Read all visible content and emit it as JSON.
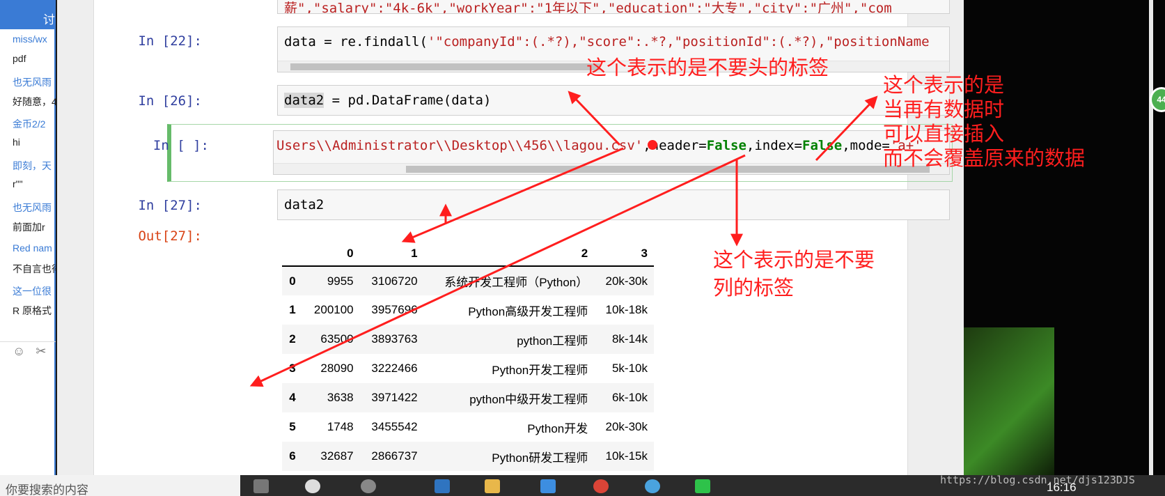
{
  "chat": {
    "tab_label": "讨",
    "messages": [
      {
        "name": "miss/wx",
        "text": "pdf"
      },
      {
        "name": "也无风雨",
        "text": "好随意，4"
      },
      {
        "name": "金币2/2",
        "text": "hi"
      },
      {
        "name": "即刻，天",
        "text": "r\"\""
      },
      {
        "name": "也无风雨",
        "text": "前面加r"
      },
      {
        "name": "Red nam",
        "text": "不自言也得"
      },
      {
        "name": "这一位很",
        "text": "R 原格式"
      }
    ],
    "emoji_icon": "☺",
    "scissors_icon": "✂"
  },
  "cells": {
    "top_partial": {
      "text": "薪\",\"salary\":\"4k-6k\",\"workYear\":\"1年以下\",\"education\":\"大专\",\"city\":\"广州\",\"com"
    },
    "c22": {
      "prompt": "In [22]:",
      "code_a": "data = re.findall(",
      "code_b": "'\"companyId\":(.*?),\"score\":.*?,\"positionId\":(.*?),\"positionName"
    },
    "c26": {
      "prompt": "In [26]:",
      "code_var": "data2",
      "code_rest": " = pd.DataFrame(data)"
    },
    "cactive": {
      "prompt": "In [ ]:",
      "code_str": "Users\\\\Administrator\\\\Desktop\\\\456\\\\lagou.csv'",
      "code_a": ",header=",
      "kw1": "False",
      "code_b": ",index=",
      "kw2": "False",
      "code_c": ",mode=",
      "code_d": "'a+'"
    },
    "c27": {
      "prompt": "In [27]:",
      "code": "data2",
      "out_prompt": "Out[27]:"
    }
  },
  "dataframe": {
    "columns": [
      "",
      "0",
      "1",
      "2",
      "3"
    ],
    "rows": [
      [
        "0",
        "9955",
        "3106720",
        "系统开发工程师（Python）",
        "20k-30k"
      ],
      [
        "1",
        "200100",
        "3957696",
        "Python高级开发工程师",
        "10k-18k"
      ],
      [
        "2",
        "63500",
        "3893763",
        "python工程师",
        "8k-14k"
      ],
      [
        "3",
        "28090",
        "3222466",
        "Python开发工程师",
        "5k-10k"
      ],
      [
        "4",
        "3638",
        "3971422",
        "python中级开发工程师",
        "6k-10k"
      ],
      [
        "5",
        "1748",
        "3455542",
        "Python开发",
        "20k-30k"
      ],
      [
        "6",
        "32687",
        "2866737",
        "Python研发工程师",
        "10k-15k"
      ]
    ]
  },
  "annotations": {
    "a1": "这个表示的是不要头的标签",
    "a2_lines": [
      "这个表示的是",
      "当再有数据时",
      "可以直接插入",
      "而不会覆盖原来的数据"
    ],
    "a3_lines": [
      "这个表示的是不要",
      "列的标签"
    ]
  },
  "badge": "44",
  "taskbar": {
    "search_text": "你要搜索的内容",
    "clock": "16:16"
  },
  "watermark": "https://blog.csdn.net/djs123DJS",
  "colors": {
    "annotation": "#ff1e1e",
    "prompt_in": "#303f9f",
    "prompt_out": "#d84315",
    "string": "#ba2121",
    "keyword": "#008000"
  }
}
